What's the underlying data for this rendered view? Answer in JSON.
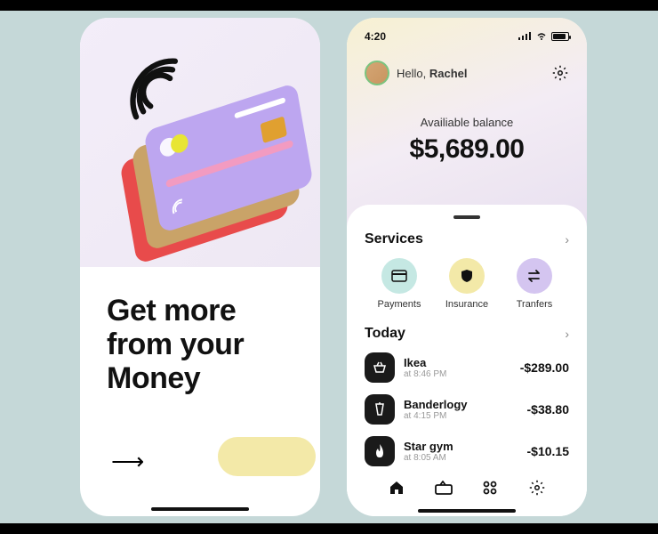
{
  "left": {
    "headline": "Get more from your Money"
  },
  "right": {
    "status": {
      "time": "4:20"
    },
    "greeting": {
      "prefix": "Hello, ",
      "name": "Rachel"
    },
    "balance": {
      "label": "Availiable balance",
      "amount": "$5,689.00"
    },
    "services": {
      "title": "Services",
      "items": [
        {
          "label": "Payments",
          "icon": "card"
        },
        {
          "label": "Insurance",
          "icon": "shield"
        },
        {
          "label": "Tranfers",
          "icon": "swap"
        }
      ]
    },
    "today": {
      "title": "Today",
      "txns": [
        {
          "name": "Ikea",
          "time": "at 8:46 PM",
          "amount": "-$289.00",
          "icon": "basket"
        },
        {
          "name": "Banderlogy",
          "time": "at 4:15 PM",
          "amount": "-$38.80",
          "icon": "drink"
        },
        {
          "name": "Star gym",
          "time": "at 8:05 AM",
          "amount": "-$10.15",
          "icon": "flame"
        }
      ]
    }
  }
}
